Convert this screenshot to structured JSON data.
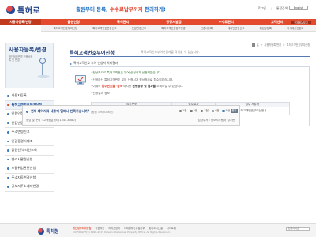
{
  "header": {
    "logo": "특허로",
    "slogan_pre": "출원부터 등록, ",
    "slogan_hl": "수수료납부까지",
    "slogan_post": " 편리하게!",
    "util": [
      "로그인",
      "통합검색"
    ],
    "lang_button": "English"
  },
  "gnb": {
    "home": "사용자등록/변경",
    "items": [
      "출원신청",
      "특허관리",
      "증명서발급",
      "수수료관리",
      "고객센터"
    ],
    "right": "전체메뉴보기"
  },
  "subbar": {
    "items": [
      "특허고객번호부여신청",
      "특허고객번호변경신고",
      "인감변경신고",
      "특허고객번호정보변경",
      "인증서등록",
      "대리인선임신고",
      "위임장등록",
      "지식재산권정보"
    ]
  },
  "left_nav": {
    "title": "사용자등록/변경",
    "desc": "개인정보변경 인증서등록 및 변경",
    "items": [
      "사용자등록",
      "특허고객번호부여신청",
      "인원인정보변경신고",
      "인감변경신고",
      "주소변경신고",
      "인감증명서대조",
      "출원인/대리인조회",
      "변리사관련신청",
      "포괄위임관련신청",
      "주소자동변경신청",
      "공보지주소계재변경"
    ],
    "active_index": 1
  },
  "main": {
    "breadcrumb": [
      "홈",
      "사용자등록/변경",
      "특허고객번호부여신청"
    ],
    "title": "특허고객번호부여신청",
    "title_desc": "특허고객번호부여신청서를 작성할 수 있습니다.",
    "notice": "특허고객번호 부여 신청서 처리결과",
    "result": {
      "line1": "· 정상적으로 특허고객번호 부여 신청서가 신청되었습니다.",
      "line2": "· 신청하신 특허고객번호 부여 신청서가 정상적으로 접수되었습니다.",
      "line3_pre": "· 이제의 ",
      "line3_a": "접수번호를 '검색'",
      "line3_b": "하시면 ",
      "line3_c": "진행상황 및 결과를",
      "line3_d": " 조회하실 수 있습니다.",
      "line4": "· 신청결과 정보"
    },
    "table": {
      "headers": [
        "접수번호",
        "접수일자",
        "접수 서류명"
      ],
      "rows": [
        [
          "4-1-2019-5040806-62",
          "2019.03.03",
          "특허고객번호부여신청서"
        ]
      ]
    }
  },
  "survey": {
    "question": "현재 페이지의 내용에 얼마나 만족하십니까?",
    "question_sub": "(평점 3.9/3046건)",
    "options": [
      "1점",
      "2점",
      "3점",
      "4점",
      "5점"
    ],
    "selected_index": 4,
    "submit": "평가",
    "bottom": "상담 및 문의 : 고객상담센터(1544-8080)",
    "owner": "담당부서 : 정보시스템과 김다현"
  },
  "footer": {
    "logo": "특허청",
    "links": [
      "개인정보처리방침",
      "이용약관",
      "저작권정책",
      "이메일무단수집거부",
      "찾아오시는길",
      "사이트맵"
    ],
    "copyright": "COPYRIGHT(C) 1996-2019 Korean Intellectual Property Office. All Rights Reserved.",
    "family_site": "관련사이트"
  }
}
